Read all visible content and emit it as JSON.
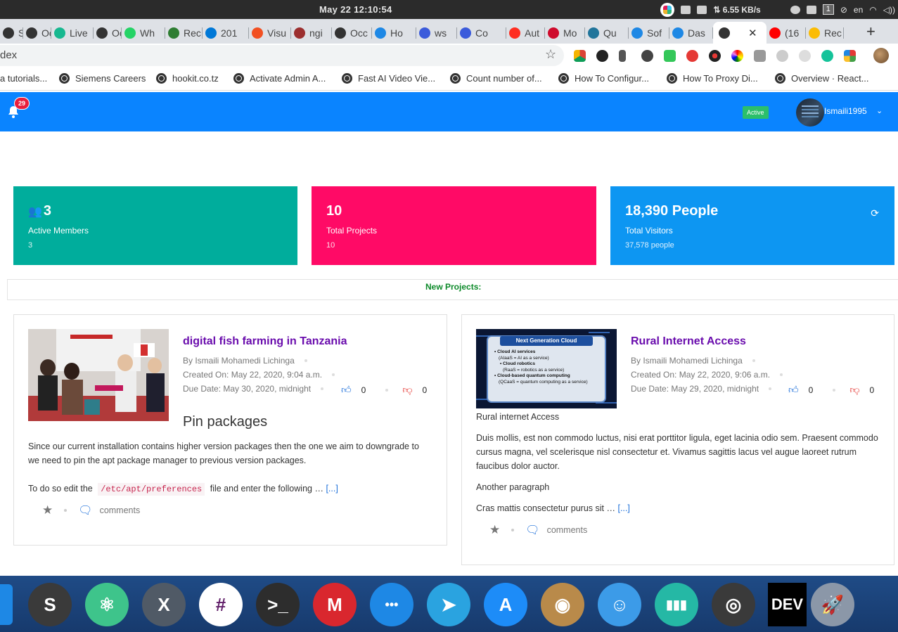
{
  "os": {
    "clock": "May 22  12:10:54",
    "net_speed": "⇅ 6.55 KB/s",
    "workspace": "1",
    "lang": "en"
  },
  "browser": {
    "tabs": [
      {
        "label": "Sele",
        "icon": "globe-icon",
        "color": "#333333"
      },
      {
        "label": "Occ",
        "icon": "globe-icon",
        "color": "#333333"
      },
      {
        "label": "Live",
        "icon": "shield-icon",
        "color": "#17b890"
      },
      {
        "label": "Occ",
        "icon": "globe-icon",
        "color": "#333333"
      },
      {
        "label": "Wh",
        "icon": "whatsapp-icon",
        "color": "#25d366"
      },
      {
        "label": "Rec",
        "icon": "grid-icon",
        "color": "#2e7d32"
      },
      {
        "label": "201",
        "icon": "vscode-icon",
        "color": "#0078d7"
      },
      {
        "label": "Visu",
        "icon": "windows-icon",
        "color": "#f25022"
      },
      {
        "label": "ngi",
        "icon": "stack-icon",
        "color": "#9c2f2f"
      },
      {
        "label": "Occ",
        "icon": "globe-icon",
        "color": "#333333"
      },
      {
        "label": "Ho",
        "icon": "s-icon",
        "color": "#1e88e5"
      },
      {
        "label": "ws",
        "icon": "loop-icon",
        "color": "#3b5bdb"
      },
      {
        "label": "Co",
        "icon": "loop-icon",
        "color": "#3b5bdb"
      },
      {
        "label": "Aut",
        "icon": "laravel-icon",
        "color": "#ff2d20"
      },
      {
        "label": "Mo",
        "icon": "huawei-icon",
        "color": "#cf0a2c"
      },
      {
        "label": "Qu",
        "icon": "wordpress-icon",
        "color": "#21759b"
      },
      {
        "label": "Sof",
        "icon": "t-icon",
        "color": "#1e88e5"
      },
      {
        "label": "Das",
        "icon": "t-icon",
        "color": "#1e88e5"
      },
      {
        "label": "",
        "icon": "globe-icon",
        "color": "#333333",
        "active": true
      },
      {
        "label": "(16",
        "icon": "youtube-icon",
        "color": "#ff0000"
      },
      {
        "label": "Rec",
        "icon": "drive-icon",
        "color": "#fbbc04"
      }
    ],
    "address": "dex",
    "bookmarks": [
      "a tutorials...",
      "Siemens Careers",
      "hookit.co.tz",
      "Activate Admin A...",
      "Fast AI Video Vie...",
      "Count number of...",
      "How To Configur...",
      "How To Proxy Di...",
      "Overview · React..."
    ]
  },
  "header": {
    "notifications_count": "29",
    "status": "Active",
    "username": "Ismaili1995"
  },
  "stats": [
    {
      "big": "3",
      "label": "Active Members",
      "small": "3",
      "color": "#00ad9c",
      "icon": "users-icon"
    },
    {
      "big": "10",
      "label": "Total Projects",
      "small": "10",
      "color": "#ff0a66"
    },
    {
      "big": "18,390 People",
      "label": "Total Visitors",
      "small": "37,578 people",
      "color": "#0d96f2",
      "icon": "refresh-icon"
    }
  ],
  "new_projects_title": "New Projects:",
  "projects": [
    {
      "title": "digital fish farming in Tanzania",
      "author": "By Ismaili Mohamedi Lichinga",
      "created": "Created On: May 22, 2020, 9:04 a.m.",
      "due": "Due Date: May 30, 2020, midnight",
      "likes": "0",
      "dislikes": "0",
      "subheading": "Pin packages",
      "para1": "Since our current installation contains higher version packages then the one we aim to downgrade to we need to pin the apt package manager to previous version packages.",
      "para2_before": "To do so edit the",
      "para2_code": "/etc/apt/preferences",
      "para2_after": "file and enter the following …",
      "read_more": "[...]",
      "comments": "comments"
    },
    {
      "title": "Rural Internet Access",
      "author": "By Ismaili Mohamedi Lichinga",
      "created": "Created On: May 22, 2020, 9:06 a.m.",
      "due": "Due Date: May 29, 2020, midnight",
      "likes": "0",
      "dislikes": "0",
      "thumb_title": "Next Generation Cloud",
      "thumb_lines": [
        {
          "head": "Cloud AI services",
          "sub": "(AIaaS = AI as a service)"
        },
        {
          "head": "Cloud robotics",
          "sub": "(RaaS = robotics as a service)"
        },
        {
          "head": "Cloud-based quantum computing",
          "sub": "(QCaaS = quantum computing as a service)"
        }
      ],
      "lead": "Rural internet Access",
      "para1": "Duis mollis, est non commodo luctus, nisi erat porttitor ligula, eget lacinia odio sem. Praesent commodo cursus magna, vel scelerisque nisl consectetur et. Vivamus sagittis lacus vel augue laoreet rutrum faucibus dolor auctor.",
      "para2": "Another paragraph",
      "para3": "Cras mattis consectetur purus sit …",
      "read_more": "[...]",
      "comments": "comments"
    }
  ],
  "dock": [
    {
      "name": "sublime-icon",
      "color": "#3a3a3a",
      "glyph": "S"
    },
    {
      "name": "atom-icon",
      "color": "#3ec48b",
      "glyph": "⚛"
    },
    {
      "name": "xampp-icon",
      "color": "#505a66",
      "glyph": "X"
    },
    {
      "name": "slack-icon",
      "color": "#ffffff",
      "glyph": "#"
    },
    {
      "name": "terminal-icon",
      "color": "#2d2d2d",
      "glyph": ">_"
    },
    {
      "name": "mega-icon",
      "color": "#d9272e",
      "glyph": "M"
    },
    {
      "name": "messages-icon",
      "color": "#1e88e5",
      "glyph": "•••"
    },
    {
      "name": "telegram-icon",
      "color": "#2aa3e0",
      "glyph": "➤"
    },
    {
      "name": "appstore-icon",
      "color": "#1d8cf8",
      "glyph": "A"
    },
    {
      "name": "contacts-icon",
      "color": "#b98a4a",
      "glyph": "◉"
    },
    {
      "name": "finder-icon",
      "color": "#3c9be8",
      "glyph": "☺"
    },
    {
      "name": "stats-icon",
      "color": "#25b8a5",
      "glyph": "▮▮▮"
    },
    {
      "name": "speaker-icon",
      "color": "#3a3a3a",
      "glyph": "◎"
    },
    {
      "name": "dev-icon",
      "color": "#000000",
      "glyph": "DEV"
    },
    {
      "name": "rocket-icon",
      "color": "#8b97a8",
      "glyph": "🚀"
    }
  ]
}
